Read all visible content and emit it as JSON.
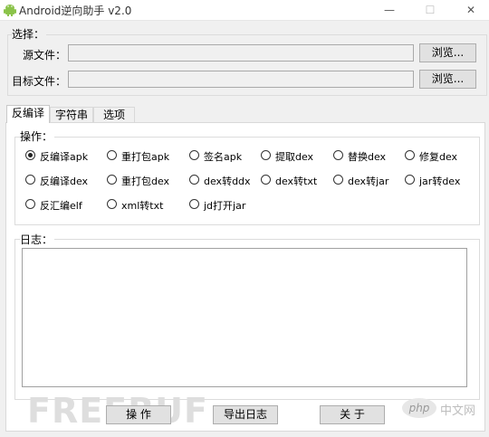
{
  "window": {
    "title": "Android逆向助手 v2.0",
    "minimize": "—",
    "maximize": "☐",
    "close": "✕"
  },
  "select_group": {
    "label": "选择：",
    "source_label": "源文件：",
    "source_value": "",
    "source_browse": "浏览...",
    "target_label": "目标文件：",
    "target_value": "",
    "target_browse": "浏览..."
  },
  "tabs": [
    "反编译",
    "字符串",
    "选项"
  ],
  "ops_group": {
    "label": "操作：",
    "options": [
      {
        "label": "反编译apk",
        "selected": true
      },
      {
        "label": "重打包apk",
        "selected": false
      },
      {
        "label": "签名apk",
        "selected": false
      },
      {
        "label": "提取dex",
        "selected": false
      },
      {
        "label": "替换dex",
        "selected": false
      },
      {
        "label": "修复dex",
        "selected": false
      },
      {
        "label": "反编译dex",
        "selected": false
      },
      {
        "label": "重打包dex",
        "selected": false
      },
      {
        "label": "dex转ddx",
        "selected": false
      },
      {
        "label": "dex转txt",
        "selected": false
      },
      {
        "label": "dex转jar",
        "selected": false
      },
      {
        "label": "jar转dex",
        "selected": false
      },
      {
        "label": "反汇编elf",
        "selected": false
      },
      {
        "label": "xml转txt",
        "selected": false
      },
      {
        "label": "jd打开jar",
        "selected": false
      }
    ]
  },
  "log_group": {
    "label": "日志：",
    "content": ""
  },
  "buttons": {
    "operate": "操 作",
    "export_log": "导出日志",
    "about": "关 于"
  },
  "watermarks": {
    "freebuf": "FREEBUF",
    "php_badge": "php",
    "php_site": "中文网"
  },
  "colors": {
    "window_bg": "#f0f0f0",
    "panel_bg": "#ffffff",
    "button_bg": "#e1e1e1"
  }
}
